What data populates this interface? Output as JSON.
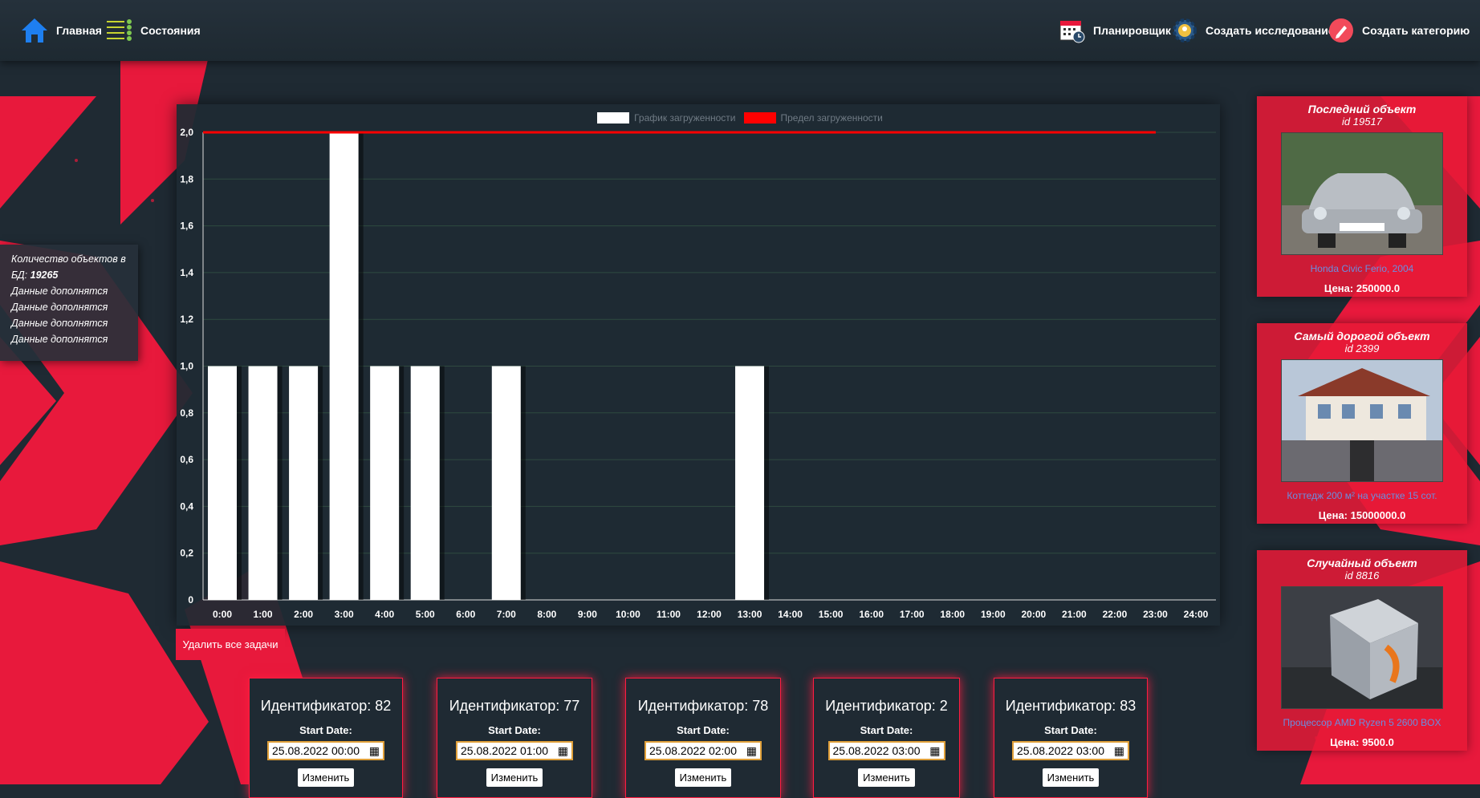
{
  "nav": {
    "home": "Главная",
    "states": "Состояния",
    "scheduler": "Планировщик",
    "create_study": "Создать исследование",
    "create_category": "Создать категорию"
  },
  "stats": {
    "count_label": "Количество объектов в БД:",
    "count_value": "19265",
    "lines": [
      "Данные дополнятся",
      "Данные дополнятся",
      "Данные дополнятся",
      "Данные дополнятся"
    ]
  },
  "chart_data": {
    "type": "bar",
    "categories": [
      "0:00",
      "1:00",
      "2:00",
      "3:00",
      "4:00",
      "5:00",
      "6:00",
      "7:00",
      "8:00",
      "9:00",
      "10:00",
      "11:00",
      "12:00",
      "13:00",
      "14:00",
      "15:00",
      "16:00",
      "17:00",
      "18:00",
      "19:00",
      "20:00",
      "21:00",
      "22:00",
      "23:00",
      "24:00"
    ],
    "series": [
      {
        "name": "График загруженности",
        "color": "#ffffff",
        "values": [
          1,
          1,
          1,
          2,
          1,
          1,
          0,
          1,
          0,
          0,
          0,
          0,
          0,
          1,
          0,
          0,
          0,
          0,
          0,
          0,
          0,
          0,
          0,
          0,
          0
        ]
      },
      {
        "name": "Предел загруженности",
        "color": "#ff0000",
        "type": "line",
        "values": [
          2,
          2,
          2,
          2,
          2,
          2,
          2,
          2,
          2,
          2,
          2,
          2,
          2,
          2,
          2,
          2,
          2,
          2,
          2,
          2,
          2,
          2,
          2,
          2,
          2
        ]
      }
    ],
    "yticks": [
      "0",
      "0,2",
      "0,4",
      "0,6",
      "0,8",
      "1,0",
      "1,2",
      "1,4",
      "1,6",
      "1,8",
      "2,0"
    ],
    "ylim": [
      0,
      2
    ],
    "grid": true,
    "legend_position": "top"
  },
  "delete_all": "Удалить все задачи",
  "tasks": [
    {
      "title": "Идентификатор: 82",
      "label": "Start Date:",
      "date": "25.08.2022 00:00",
      "button": "Изменить"
    },
    {
      "title": "Идентификатор: 77",
      "label": "Start Date:",
      "date": "25.08.2022 01:00",
      "button": "Изменить"
    },
    {
      "title": "Идентификатор: 78",
      "label": "Start Date:",
      "date": "25.08.2022 02:00",
      "button": "Изменить"
    },
    {
      "title": "Идентификатор: 2",
      "label": "Start Date:",
      "date": "25.08.2022 03:00",
      "button": "Изменить"
    },
    {
      "title": "Идентификатор: 83",
      "label": "Start Date:",
      "date": "25.08.2022 03:00",
      "button": "Изменить"
    }
  ],
  "objects": [
    {
      "heading": "Последний объект",
      "id": "id 19517",
      "name": "Honda Civic Ferio, 2004",
      "price": "Цена: 250000.0"
    },
    {
      "heading": "Самый дорогой объект",
      "id": "id 2399",
      "name": "Коттедж 200 м² на участке 15 сот.",
      "price": "Цена: 15000000.0"
    },
    {
      "heading": "Случайный объект",
      "id": "id 8816",
      "name": "Процессор AMD Ryzen 5 2600 BOX",
      "price": "Цена: 9500.0"
    }
  ],
  "colors": {
    "accent": "#e8193c",
    "background": "#1f2a33",
    "link": "#6b8ee0"
  }
}
